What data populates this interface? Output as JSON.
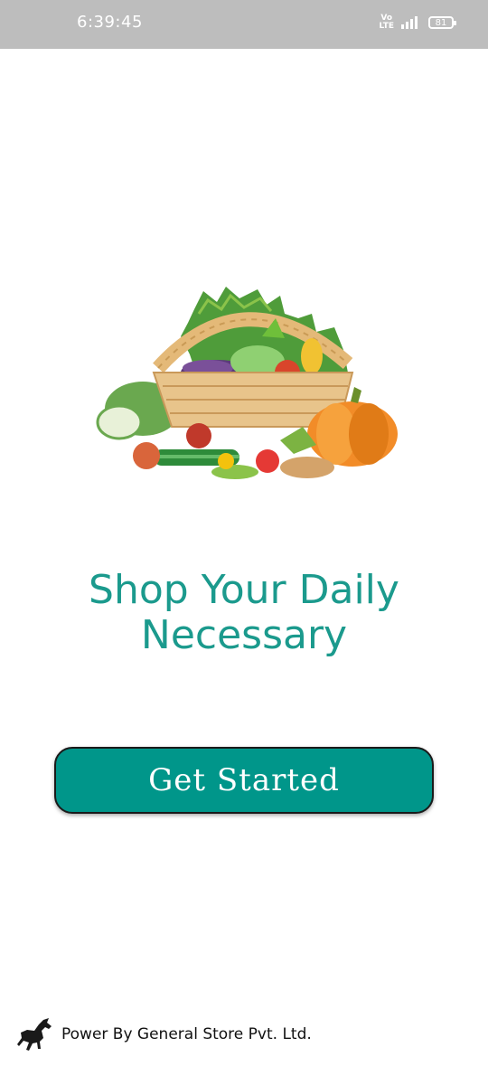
{
  "status_bar": {
    "time": "6:39:45",
    "network_label": "Vo LTE",
    "battery_level": "81"
  },
  "hero": {
    "image_icon": "vegetable-basket-illustration"
  },
  "headline": {
    "line1": "Shop Your Daily",
    "line2": "Necessary"
  },
  "cta": {
    "label": "Get Started"
  },
  "footer": {
    "logo_icon": "horse-logo-icon",
    "text": "Power By General Store Pvt. Ltd."
  },
  "colors": {
    "accent": "#00968a",
    "headline": "#1b9a8d",
    "status_bar": "#bdbdbd"
  }
}
